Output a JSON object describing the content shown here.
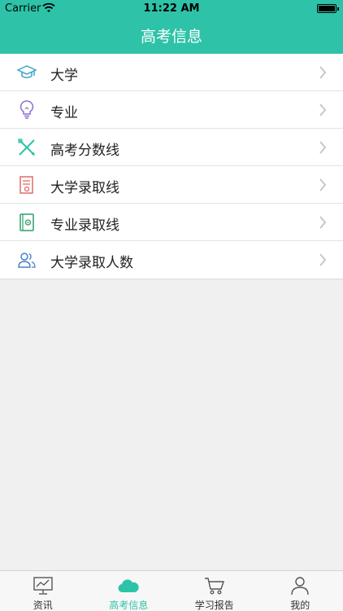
{
  "status_bar": {
    "carrier": "Carrier",
    "time": "11:22 AM"
  },
  "nav": {
    "title": "高考信息"
  },
  "menu": {
    "items": [
      {
        "label": "大学",
        "icon": "graduation-cap-icon",
        "color": "#3ba7c9"
      },
      {
        "label": "专业",
        "icon": "lightbulb-icon",
        "color": "#8b6fcf"
      },
      {
        "label": "高考分数线",
        "icon": "pencil-cross-icon",
        "color": "#2ec3a8"
      },
      {
        "label": "大学录取线",
        "icon": "scroll-certificate-icon",
        "color": "#e26a6a"
      },
      {
        "label": "专业录取线",
        "icon": "notebook-at-icon",
        "color": "#2e9e6b"
      },
      {
        "label": "大学录取人数",
        "icon": "users-icon",
        "color": "#4a80c7"
      }
    ]
  },
  "tabbar": {
    "tabs": [
      {
        "label": "资讯",
        "icon": "chart-monitor-icon"
      },
      {
        "label": "高考信息",
        "icon": "cloud-icon"
      },
      {
        "label": "学习报告",
        "icon": "cart-icon"
      },
      {
        "label": "我的",
        "icon": "person-icon"
      }
    ],
    "active_index": 1
  },
  "theme": {
    "accent": "#2ec3a8"
  }
}
